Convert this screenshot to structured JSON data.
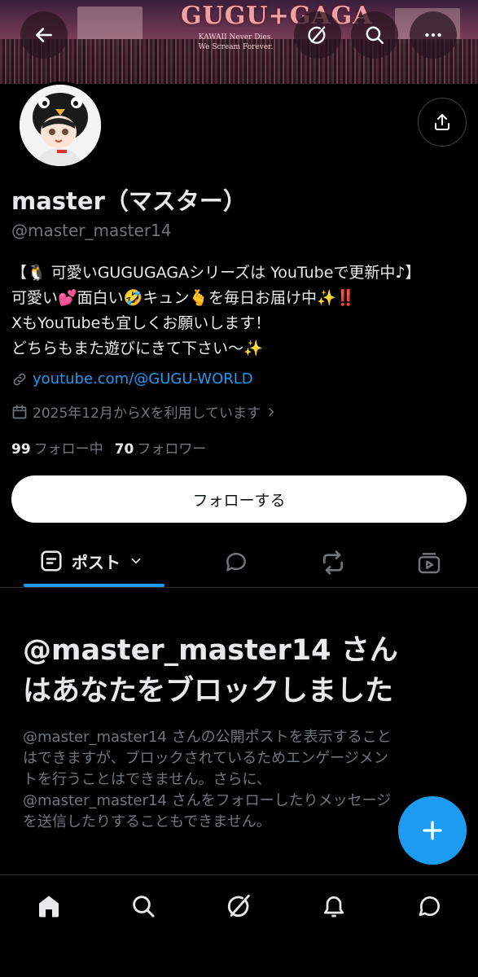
{
  "banner": {
    "logo_title": "GUGU+GAGA",
    "logo_sub_line1": "KAWAII Never Dies.",
    "logo_sub_line2": "We Scream Forever."
  },
  "top_bar": {
    "back_icon": "arrow-left-icon",
    "grok_icon": "grok-icon",
    "search_icon": "search-icon",
    "more_icon": "more-horizontal-icon"
  },
  "profile": {
    "name": "master（マスター）",
    "handle": "@master_master14",
    "bio_lines": [
      "【🐧 可愛いGUGUGAGAシリーズは YouTubeで更新中♪】",
      "可愛い💕面白い🤣キュン🫰を毎日お届け中✨‼️",
      "XもYouTubeも宜しくお願いします！",
      "どちらもまた遊びにきて下さい〜✨"
    ],
    "link": "youtube.com/@GUGU-WORLD",
    "joined": "2025年12月からXを利用しています",
    "following_count": "99",
    "following_label": "フォロー中",
    "followers_count": "70",
    "followers_label": "フォロワー",
    "follow_button": "フォローする"
  },
  "tabs": {
    "posts_label": "ポスト"
  },
  "block_notice": {
    "title_lines": [
      "@master_master14 さん",
      "はあなたをブロックしました"
    ],
    "desc_lines": [
      "@master_master14 さんの公開ポストを表示すること",
      "はできますが、ブロックされているためエンゲージメン",
      "トを行うことはできません。さらに、",
      "@master_master14 さんをフォローしたりメッセージ",
      "を送信したりすることもできません。"
    ]
  },
  "colors": {
    "accent": "#1d9bf0",
    "background": "#000000",
    "text_primary": "#e7e9ea",
    "text_secondary": "#71767b"
  }
}
